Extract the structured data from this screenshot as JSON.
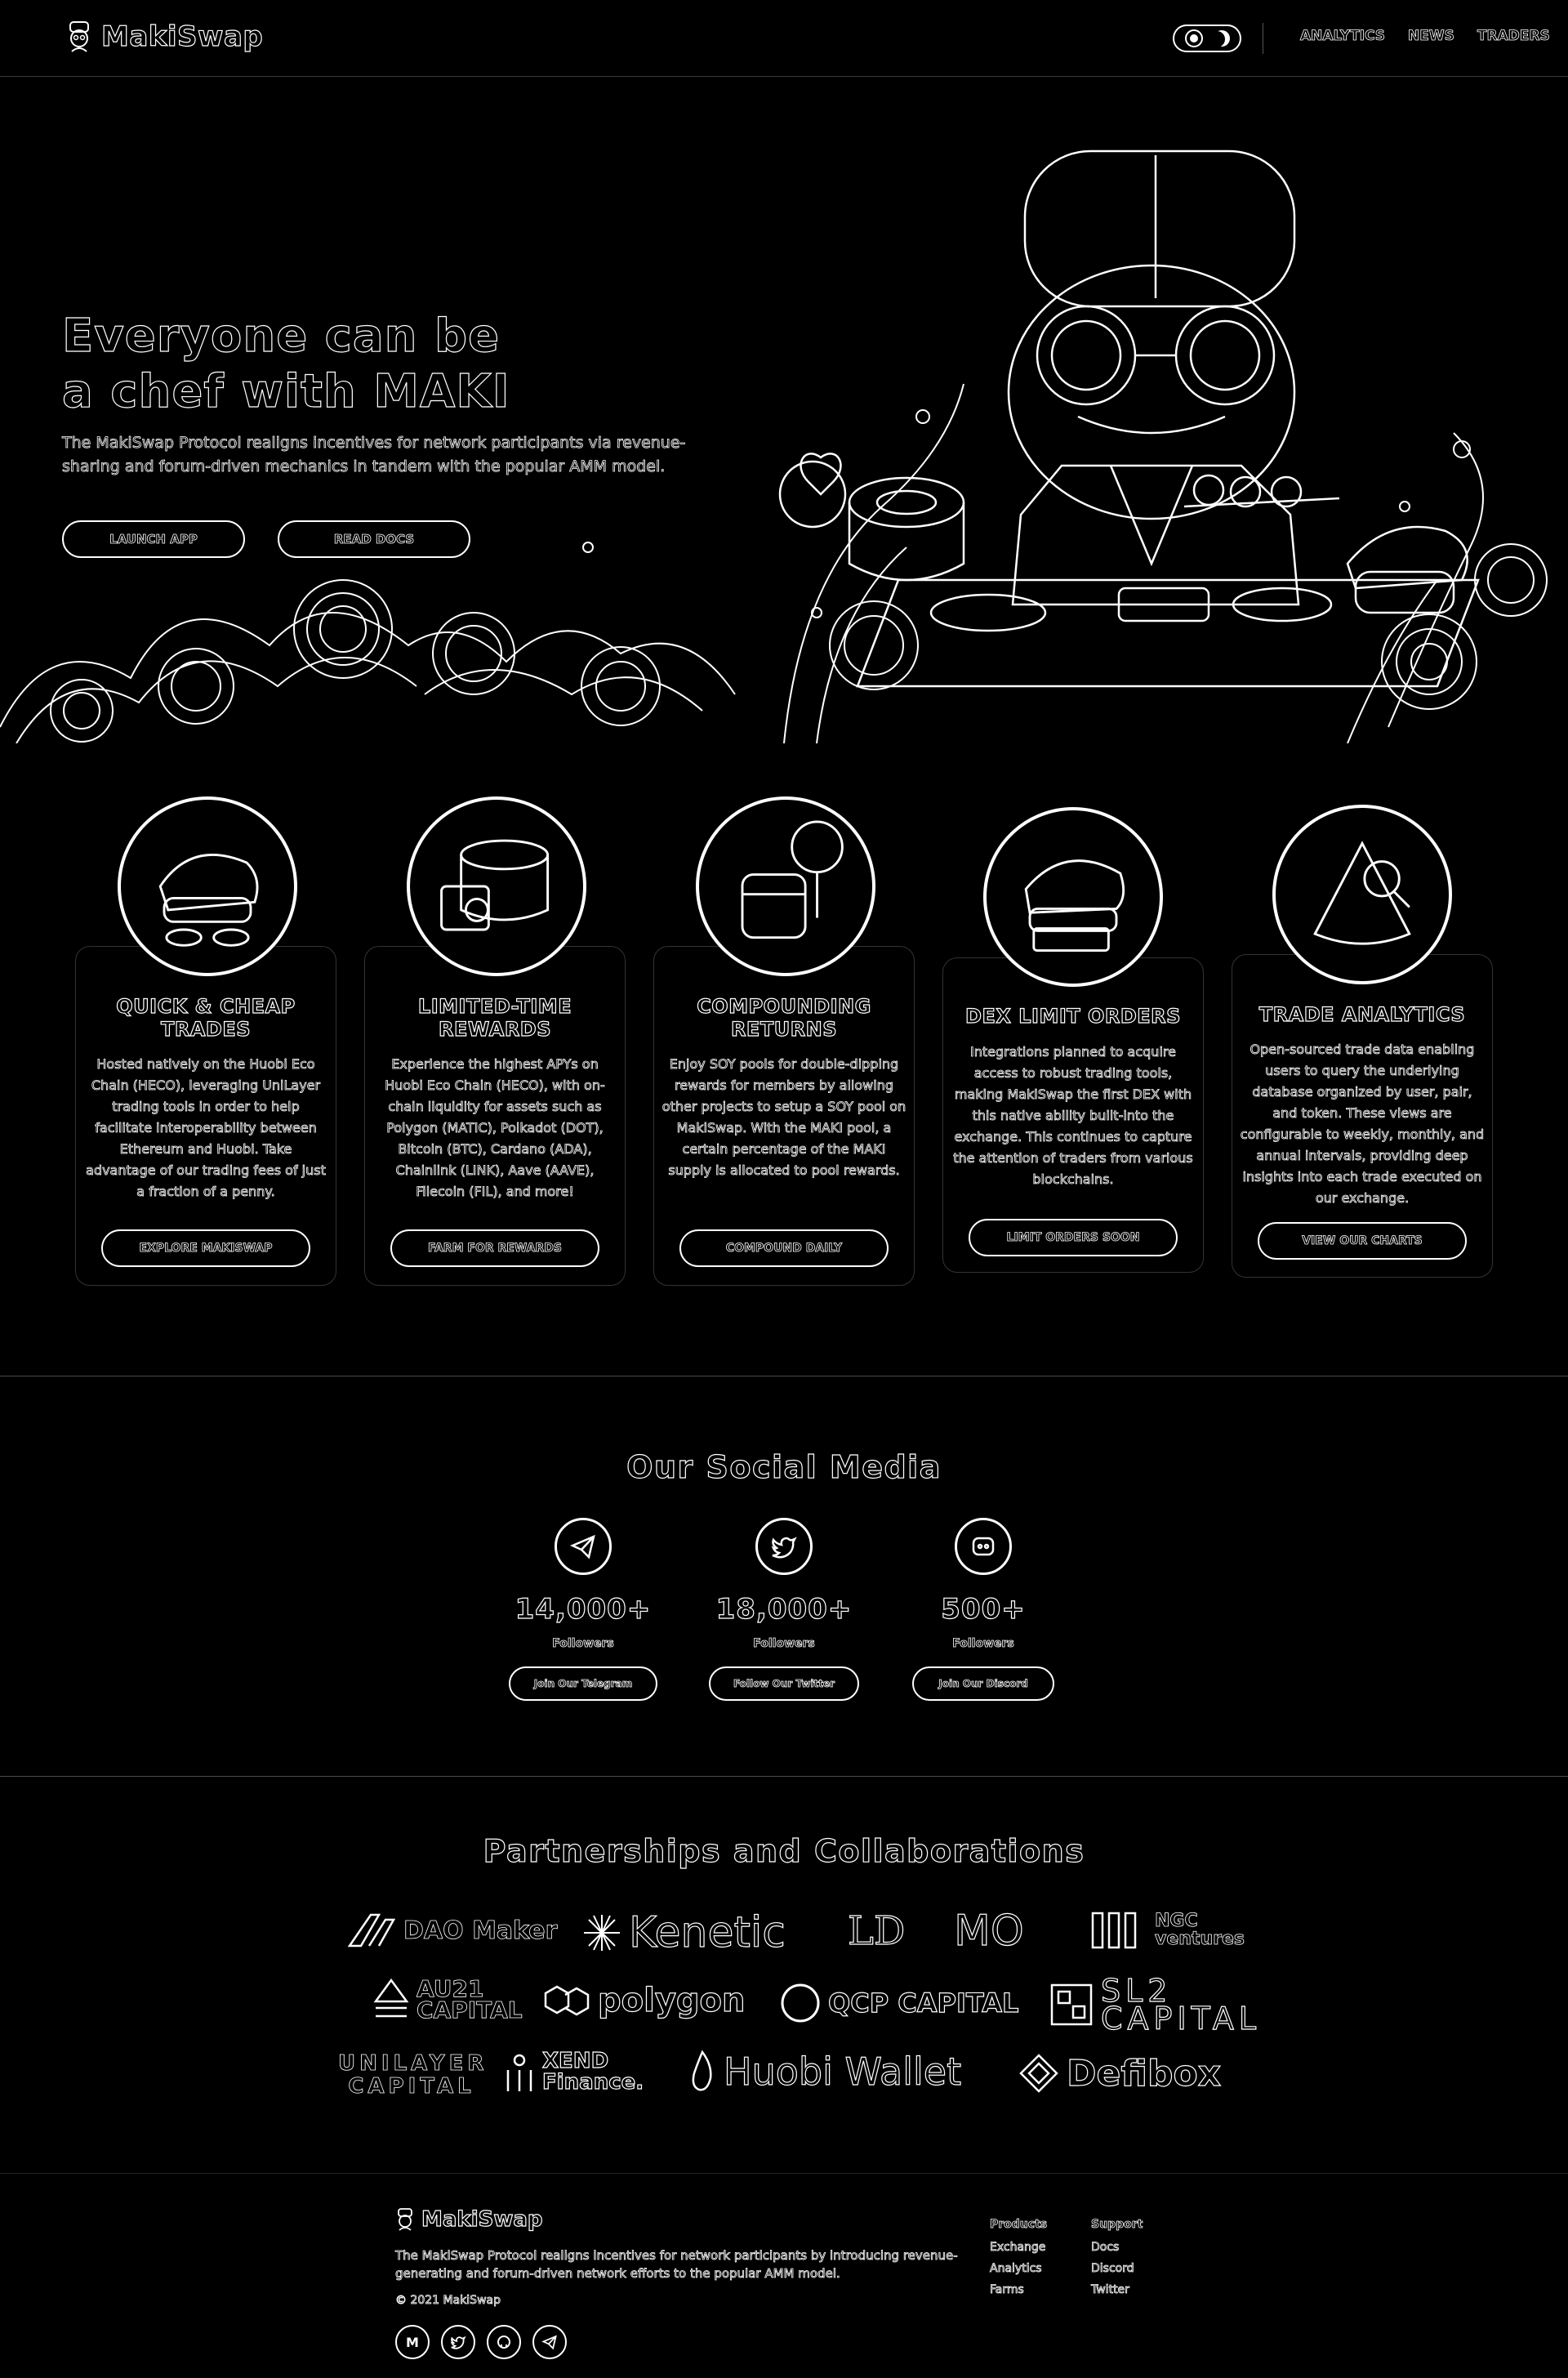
{
  "nav": {
    "brand": "MakiSwap",
    "links": [
      "ANALYTICS",
      "NEWS",
      "TRADERS"
    ]
  },
  "hero": {
    "title": "Everyone can be a chef with MAKI",
    "subtitle": "The MakiSwap Protocol realigns incentives for network participants via revenue-sharing and forum-driven mechanics in tandem with the popular AMM model.",
    "launch_label": "LAUNCH APP",
    "docs_label": "READ DOCS"
  },
  "features": [
    {
      "title": "QUICK & CHEAP TRADES",
      "desc": "Hosted natively on the Huobi Eco Chain (HECO), leveraging UniLayer trading tools in order to help facilitate interoperability between Ethereum and Huobi. Take advantage of our trading fees of just a fraction of a penny.",
      "button": "EXPLORE MAKISWAP"
    },
    {
      "title": "LIMITED-TIME REWARDS",
      "desc": "Experience the highest APYs on Huobi Eco Chain (HECO), with on-chain liquidity for assets such as Polygon (MATIC), Polkadot (DOT), Bitcoin (BTC), Cardano (ADA), Chainlink (LINK), Aave (AAVE), Filecoin (FIL), and more!",
      "button": "FARM FOR REWARDS"
    },
    {
      "title": "COMPOUNDING RETURNS",
      "desc": "Enjoy SOY pools for double-dipping rewards for members by allowing other projects to setup a SOY pool on MakiSwap. With the MAKI pool, a certain percentage of the MAKI supply is allocated to pool rewards.",
      "button": "COMPOUND DAILY"
    },
    {
      "title": "DEX LIMIT ORDERS",
      "desc": "Integrations planned to acquire access to robust trading tools, making MakiSwap the first DEX with this native ability built-into the exchange. This continues to capture the attention of traders from various blockchains.",
      "button": "LIMIT ORDERS SOON"
    },
    {
      "title": "TRADE ANALYTICS",
      "desc": "Open-sourced trade data enabling users to query the underlying database organized by user, pair, and token. These views are configurable to weekly, monthly, and annual intervals, providing deep insights into each trade executed on our exchange.",
      "button": "VIEW OUR CHARTS"
    }
  ],
  "social": {
    "title": "Our Social Media",
    "items": [
      {
        "icon": "telegram-icon",
        "count": "14,000+",
        "label": "Followers",
        "button": "Join Our Telegram"
      },
      {
        "icon": "twitter-icon",
        "count": "18,000+",
        "label": "Followers",
        "button": "Follow Our Twitter"
      },
      {
        "icon": "discord-icon",
        "count": "500+",
        "label": "Followers",
        "button": "Join Our Discord"
      }
    ]
  },
  "partners": {
    "title": "Partnerships and Collaborations",
    "logos": [
      "DAO Maker",
      "Kenetic",
      "LD",
      "MO",
      "NGC ventures",
      "AU21 CAPITAL",
      "polygon",
      "QCP CAPITAL",
      "SL2 CAPITAL",
      "UNILAYER CAPITAL",
      "XEND Finance.",
      "Huobi Wallet",
      "Defibox"
    ]
  },
  "footer": {
    "brand": "MakiSwap",
    "desc": "The MakiSwap Protocol realigns incentives for network participants by introducing revenue-generating and forum-driven network efforts to the popular AMM model.",
    "copyright": "© 2021 MakiSwap",
    "socials": [
      "M",
      "t",
      "gh",
      "tg"
    ],
    "products_head": "Products",
    "products": [
      "Exchange",
      "Analytics",
      "Farms"
    ],
    "support_head": "Support",
    "support": [
      "Docs",
      "Discord",
      "Twitter"
    ]
  },
  "colors": {
    "background": "#000000",
    "foreground": "#ffffff",
    "divider": "#4a4a4a"
  }
}
